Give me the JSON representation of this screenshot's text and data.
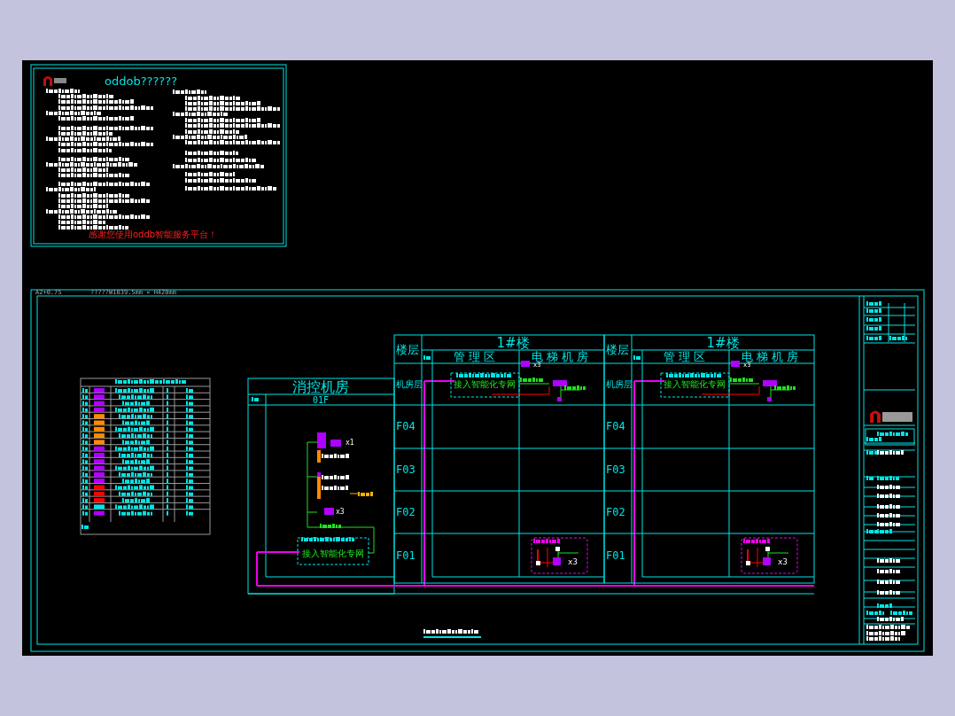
{
  "title_sheet": {
    "title": "oddob??????",
    "thanks": "感谢您使用oddb智能服务平台！"
  },
  "sheet": {
    "size_label": "A2+0.75",
    "dimensions": "?????W1039.5mm × H420mm"
  },
  "control_room": {
    "title": "消控机房",
    "floor": "01F",
    "network_label": "接入智能化专网",
    "counts": [
      "x1",
      "x3"
    ]
  },
  "buildings": [
    {
      "title": "1#楼",
      "floor_header": "楼层",
      "zones": [
        "管理区",
        "电梯机房"
      ],
      "floors": [
        "机房层",
        "F04",
        "F03",
        "F02",
        "F01"
      ],
      "network_label": "接入智能化专网",
      "counts": [
        "x3",
        "x3"
      ]
    },
    {
      "title": "1#楼",
      "floor_header": "楼层",
      "zones": [
        "管理区",
        "电梯机房"
      ],
      "floors": [
        "机房层",
        "F04",
        "F03",
        "F02",
        "F01"
      ],
      "network_label": "接入智能化专网",
      "counts": [
        "x3",
        "x3"
      ]
    }
  ]
}
